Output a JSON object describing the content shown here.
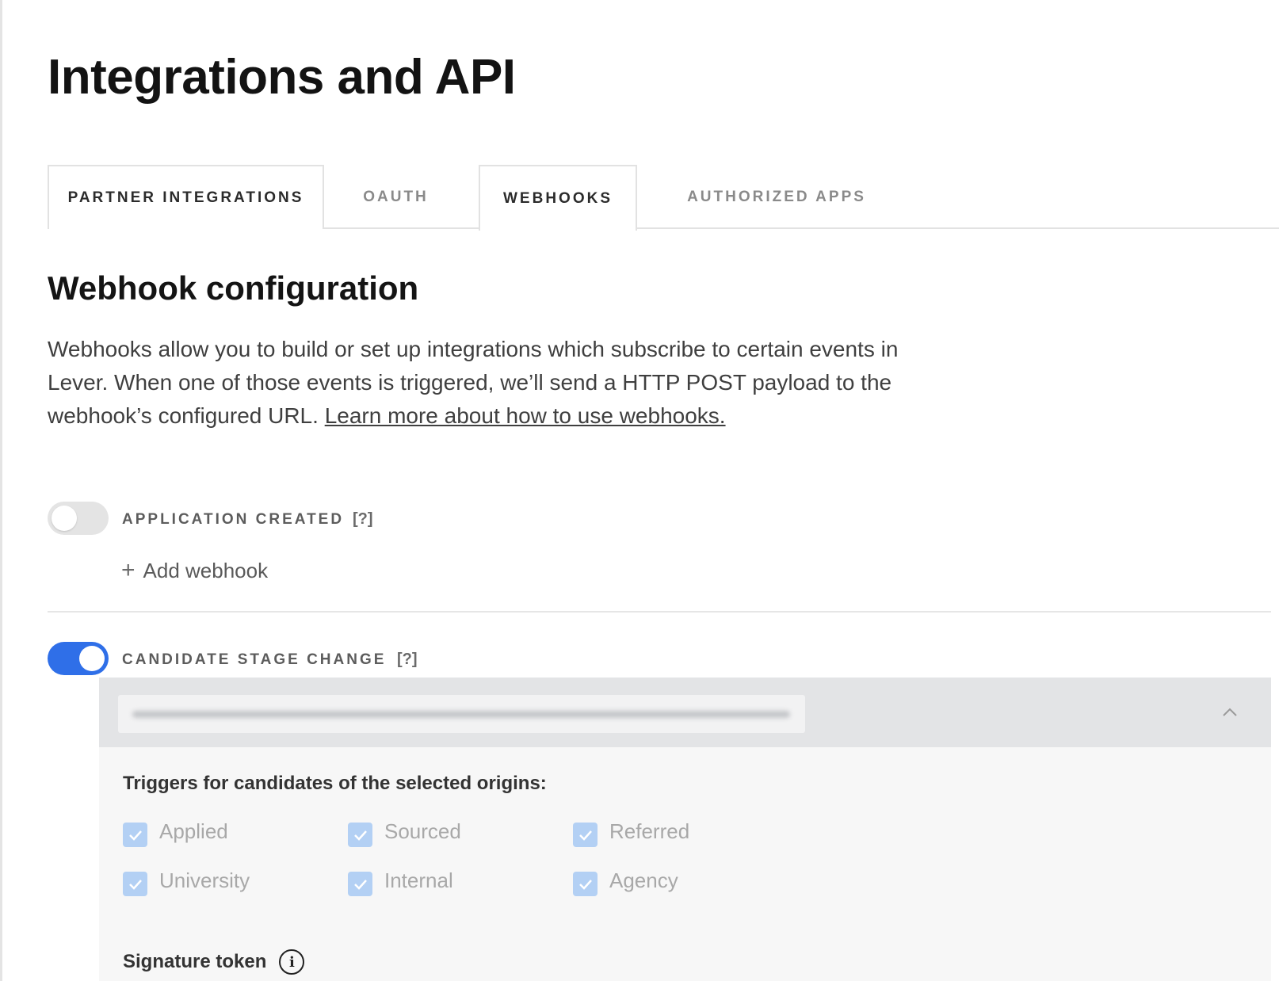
{
  "page": {
    "title": "Integrations and API"
  },
  "tabs": [
    {
      "label": "PARTNER INTEGRATIONS"
    },
    {
      "label": "OAUTH"
    },
    {
      "label": "WEBHOOKS"
    },
    {
      "label": "AUTHORIZED APPS"
    }
  ],
  "active_tab": "WEBHOOKS",
  "section": {
    "title": "Webhook configuration",
    "description": "Webhooks allow you to build or set up integrations which subscribe to certain events in Lever. When one of those events is triggered, we’ll send a HTTP POST payload to the webhook’s configured URL.",
    "link_text": "Learn more about how to use webhooks."
  },
  "events": {
    "application_created": {
      "label": "APPLICATION CREATED",
      "help": "[?]",
      "enabled": false,
      "add_label": "Add webhook"
    },
    "candidate_stage_change": {
      "label": "CANDIDATE STAGE CHANGE",
      "help": "[?]",
      "enabled": true
    }
  },
  "webhook_panel": {
    "triggers_heading": "Triggers for candidates of the selected origins:",
    "origins": [
      {
        "label": "Applied",
        "checked": true
      },
      {
        "label": "Sourced",
        "checked": true
      },
      {
        "label": "Referred",
        "checked": true
      },
      {
        "label": "University",
        "checked": true
      },
      {
        "label": "Internal",
        "checked": true
      },
      {
        "label": "Agency",
        "checked": true
      }
    ],
    "signature_label": "Signature token"
  },
  "colors": {
    "accent": "#2f6fe8",
    "checkbox_disabled": "#b3d0f4",
    "panel_header": "#e3e4e6",
    "panel_body": "#f7f7f7"
  }
}
